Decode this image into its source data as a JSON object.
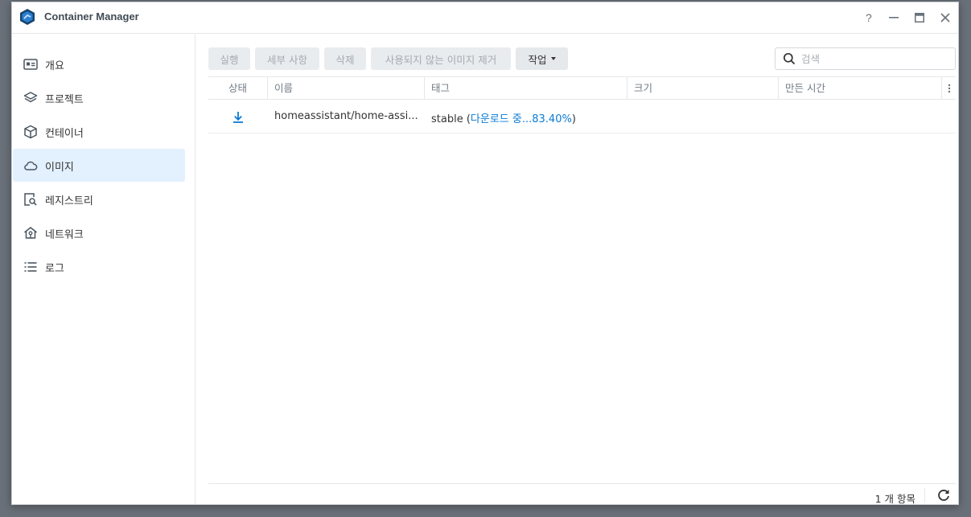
{
  "window": {
    "title": "Container Manager",
    "controls": [
      "help-icon",
      "minimize-icon",
      "maximize-icon",
      "close-icon"
    ]
  },
  "sidebar": {
    "items": [
      {
        "label": "개요",
        "icon": "overview-icon"
      },
      {
        "label": "프로젝트",
        "icon": "layers-icon"
      },
      {
        "label": "컨테이너",
        "icon": "cube-icon"
      },
      {
        "label": "이미지",
        "icon": "cloud-icon",
        "active": true
      },
      {
        "label": "레지스트리",
        "icon": "registry-search-icon"
      },
      {
        "label": "네트워크",
        "icon": "network-home-icon"
      },
      {
        "label": "로그",
        "icon": "list-icon"
      }
    ]
  },
  "toolbar": {
    "run_label": "실행",
    "details_label": "세부 사항",
    "delete_label": "삭제",
    "remove_unused_label": "사용되지 않는 이미지 제거",
    "action_label": "작업"
  },
  "search": {
    "placeholder": "검색",
    "value": ""
  },
  "table": {
    "columns": [
      "상태",
      "이름",
      "태그",
      "크기",
      "만든 시간"
    ],
    "rows": [
      {
        "status_icon": "download-icon",
        "name": "homeassistant/home-assi...",
        "tag": "stable",
        "tag_open": " (",
        "tag_progress": "다운로드 중...83.40%",
        "tag_close": ")",
        "size": "",
        "created": ""
      }
    ]
  },
  "footer": {
    "count_label": "1 개 항목"
  },
  "colors": {
    "accent": "#0a7bd6",
    "active_bg": "#e3f0fd",
    "disabled_text": "#a3aab2"
  }
}
